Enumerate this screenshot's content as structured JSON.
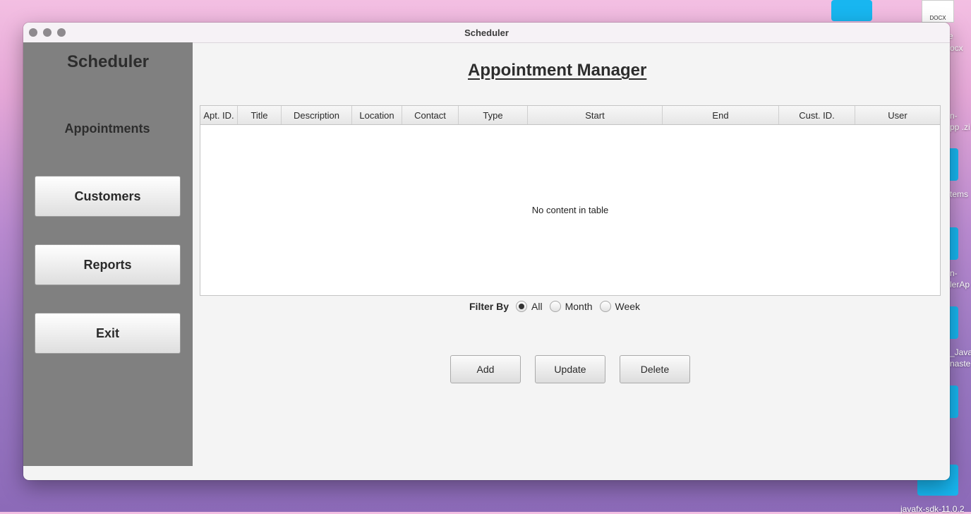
{
  "window": {
    "title": "Scheduler"
  },
  "sidebar": {
    "title": "Scheduler",
    "current": "Appointments",
    "buttons": {
      "customers": "Customers",
      "reports": "Reports",
      "exit": "Exit"
    }
  },
  "main": {
    "heading": "Appointment Manager",
    "table": {
      "columns": [
        "Apt. ID.",
        "Title",
        "Description",
        "Location",
        "Contact",
        "Type",
        "Start",
        "End",
        "Cust. ID.",
        "User"
      ],
      "empty_message": "No content in table"
    },
    "filter": {
      "label": "Filter By",
      "options": [
        "All",
        "Month",
        "Week"
      ],
      "selected": "All"
    },
    "actions": {
      "add": "Add",
      "update": "Update",
      "delete": "Delete"
    }
  },
  "desktop": {
    "doc_label": "DOCX",
    "fragments": [
      "e",
      "ocx",
      "n-",
      "pp .zi",
      "tems",
      "n-",
      "lerAp",
      "_Java",
      "naste",
      "javafx-sdk-11.0.2"
    ]
  }
}
